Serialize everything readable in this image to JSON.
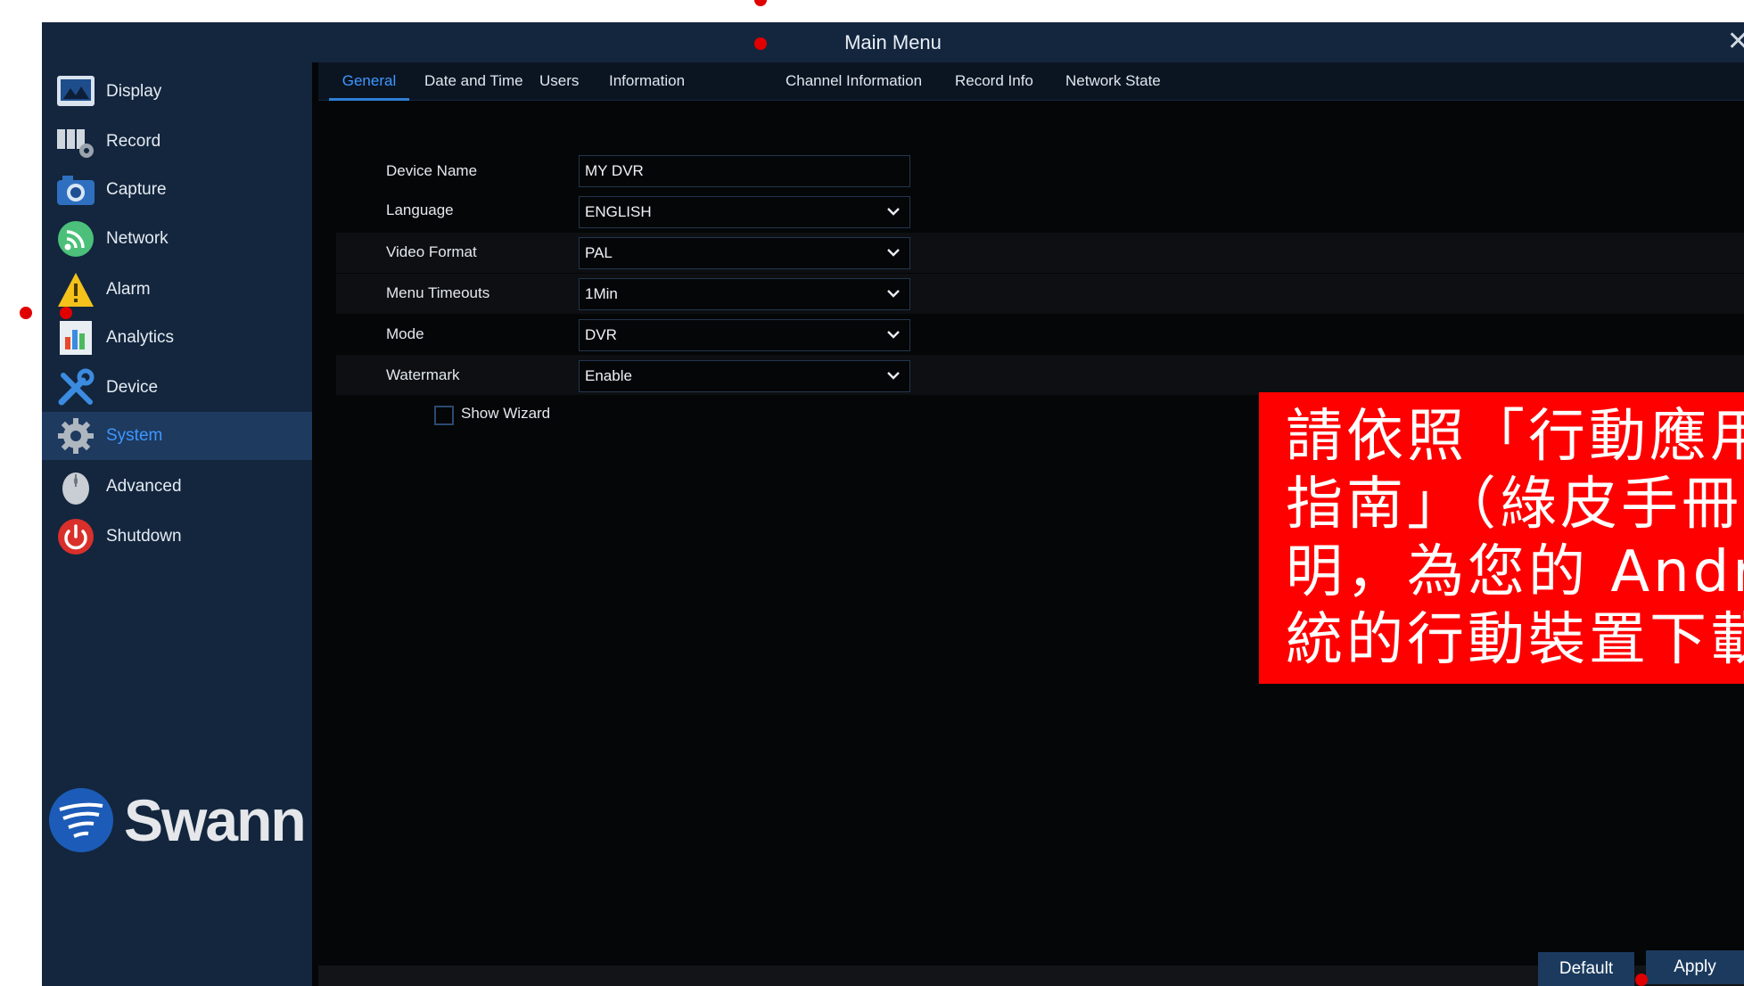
{
  "window": {
    "title": "Main Menu"
  },
  "sidebar": {
    "items": [
      {
        "label": "Display",
        "icon": "display-icon"
      },
      {
        "label": "Record",
        "icon": "record-icon"
      },
      {
        "label": "Capture",
        "icon": "camera-icon"
      },
      {
        "label": "Network",
        "icon": "network-icon"
      },
      {
        "label": "Alarm",
        "icon": "alarm-icon"
      },
      {
        "label": "Analytics",
        "icon": "analytics-icon"
      },
      {
        "label": "Device",
        "icon": "device-icon"
      },
      {
        "label": "System",
        "icon": "gear-icon",
        "active": true
      },
      {
        "label": "Advanced",
        "icon": "mouse-icon"
      },
      {
        "label": "Shutdown",
        "icon": "power-icon"
      }
    ],
    "logo_text": "Swann"
  },
  "tabs": [
    {
      "label": "General",
      "active": true
    },
    {
      "label": "Date and Time"
    },
    {
      "label": "Users"
    },
    {
      "label": "Information"
    },
    {
      "label": "Channel Information"
    },
    {
      "label": "Record Info"
    },
    {
      "label": "Network State"
    }
  ],
  "form": {
    "fields": [
      {
        "label": "Device Name",
        "value": "MY DVR",
        "type": "text"
      },
      {
        "label": "Language",
        "value": "ENGLISH",
        "type": "select"
      },
      {
        "label": "Video Format",
        "value": "PAL",
        "type": "select"
      },
      {
        "label": "Menu Timeouts",
        "value": "1Min",
        "type": "select"
      },
      {
        "label": "Mode",
        "value": "DVR",
        "type": "select"
      },
      {
        "label": "Watermark",
        "value": "Enable",
        "type": "select"
      }
    ],
    "show_wizard": {
      "label": "Show Wizard",
      "checked": false
    }
  },
  "overlay": {
    "lines": [
      "請依照「行動應用",
      "指南」（綠皮手冊",
      "明，為您的 Andro",
      "統的行動裝置下載"
    ]
  },
  "buttons": {
    "default_label": "Default",
    "apply_label": "Apply"
  },
  "colors": {
    "accent": "#3e97ff",
    "panel": "#13263e",
    "overlay": "#ff0000",
    "marker": "#e00000"
  }
}
